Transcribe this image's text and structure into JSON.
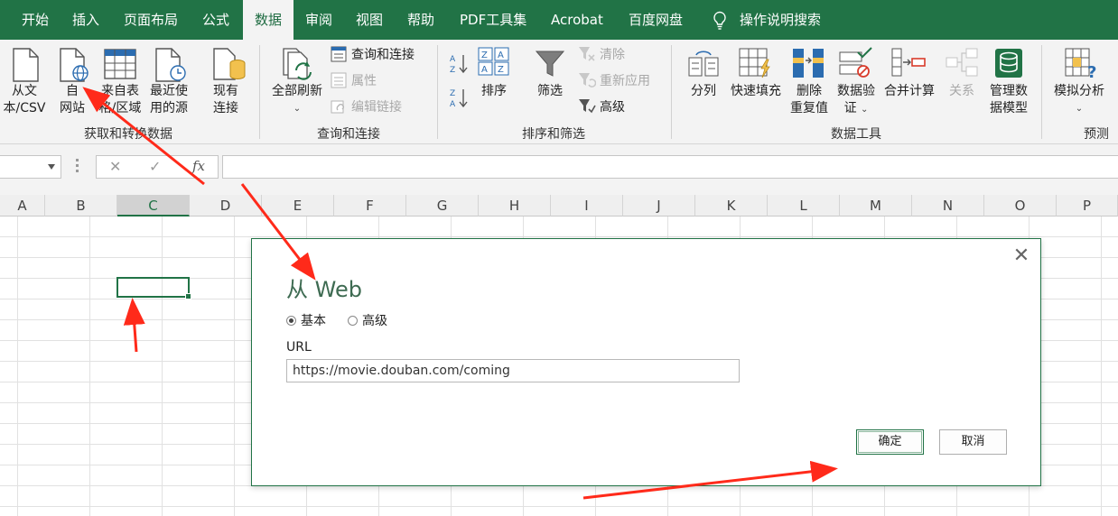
{
  "menu": {
    "tabs": [
      "开始",
      "插入",
      "页面布局",
      "公式",
      "数据",
      "审阅",
      "视图",
      "帮助",
      "PDF工具集",
      "Acrobat",
      "百度网盘"
    ],
    "active_tab": "数据",
    "search_label": "操作说明搜索"
  },
  "ribbon": {
    "get_transform": {
      "group_label": "获取和转换数据",
      "from_text_csv": [
        "从文",
        "本/CSV"
      ],
      "from_web": [
        "自",
        "网站"
      ],
      "from_table": [
        "来自表",
        "格/区域"
      ],
      "recent_sources": [
        "最近使",
        "用的源"
      ],
      "existing_connections": [
        "现有",
        "连接"
      ]
    },
    "queries": {
      "group_label": "查询和连接",
      "refresh_all": "全部刷新",
      "queries_connections": "查询和连接",
      "properties": "属性",
      "edit_links": "编辑链接"
    },
    "sort_filter": {
      "group_label": "排序和筛选",
      "sort": "排序",
      "filter": "筛选",
      "clear": "清除",
      "reapply": "重新应用",
      "advanced": "高级"
    },
    "data_tools": {
      "group_label": "数据工具",
      "text_to_columns": "分列",
      "flash_fill": "快速填充",
      "remove_duplicates": [
        "删除",
        "重复值"
      ],
      "data_validation": [
        "数据验",
        "证"
      ],
      "consolidate": "合并计算",
      "relationships": "关系",
      "manage_data_model": [
        "管理数",
        "据模型"
      ]
    },
    "forecast": {
      "group_label": "预测",
      "what_if": "模拟分析"
    }
  },
  "formula_bar": {
    "cancel_symbol": "✕",
    "enter_symbol": "✓",
    "fx_symbol": "fx",
    "value": ""
  },
  "grid": {
    "columns": [
      "A",
      "B",
      "C",
      "D",
      "E",
      "F",
      "G",
      "H",
      "I",
      "J",
      "K",
      "L",
      "M",
      "N",
      "O",
      "P"
    ],
    "selected_column": "C"
  },
  "dialog": {
    "title": "从 Web",
    "close_symbol": "✕",
    "mode_basic": "基本",
    "mode_advanced": "高级",
    "selected_mode": "基本",
    "url_label": "URL",
    "url_value": "https://movie.douban.com/coming",
    "ok_label": "确定",
    "cancel_label": "取消"
  },
  "colors": {
    "excel_green": "#217346",
    "annotation_red": "#ff2a1a"
  }
}
